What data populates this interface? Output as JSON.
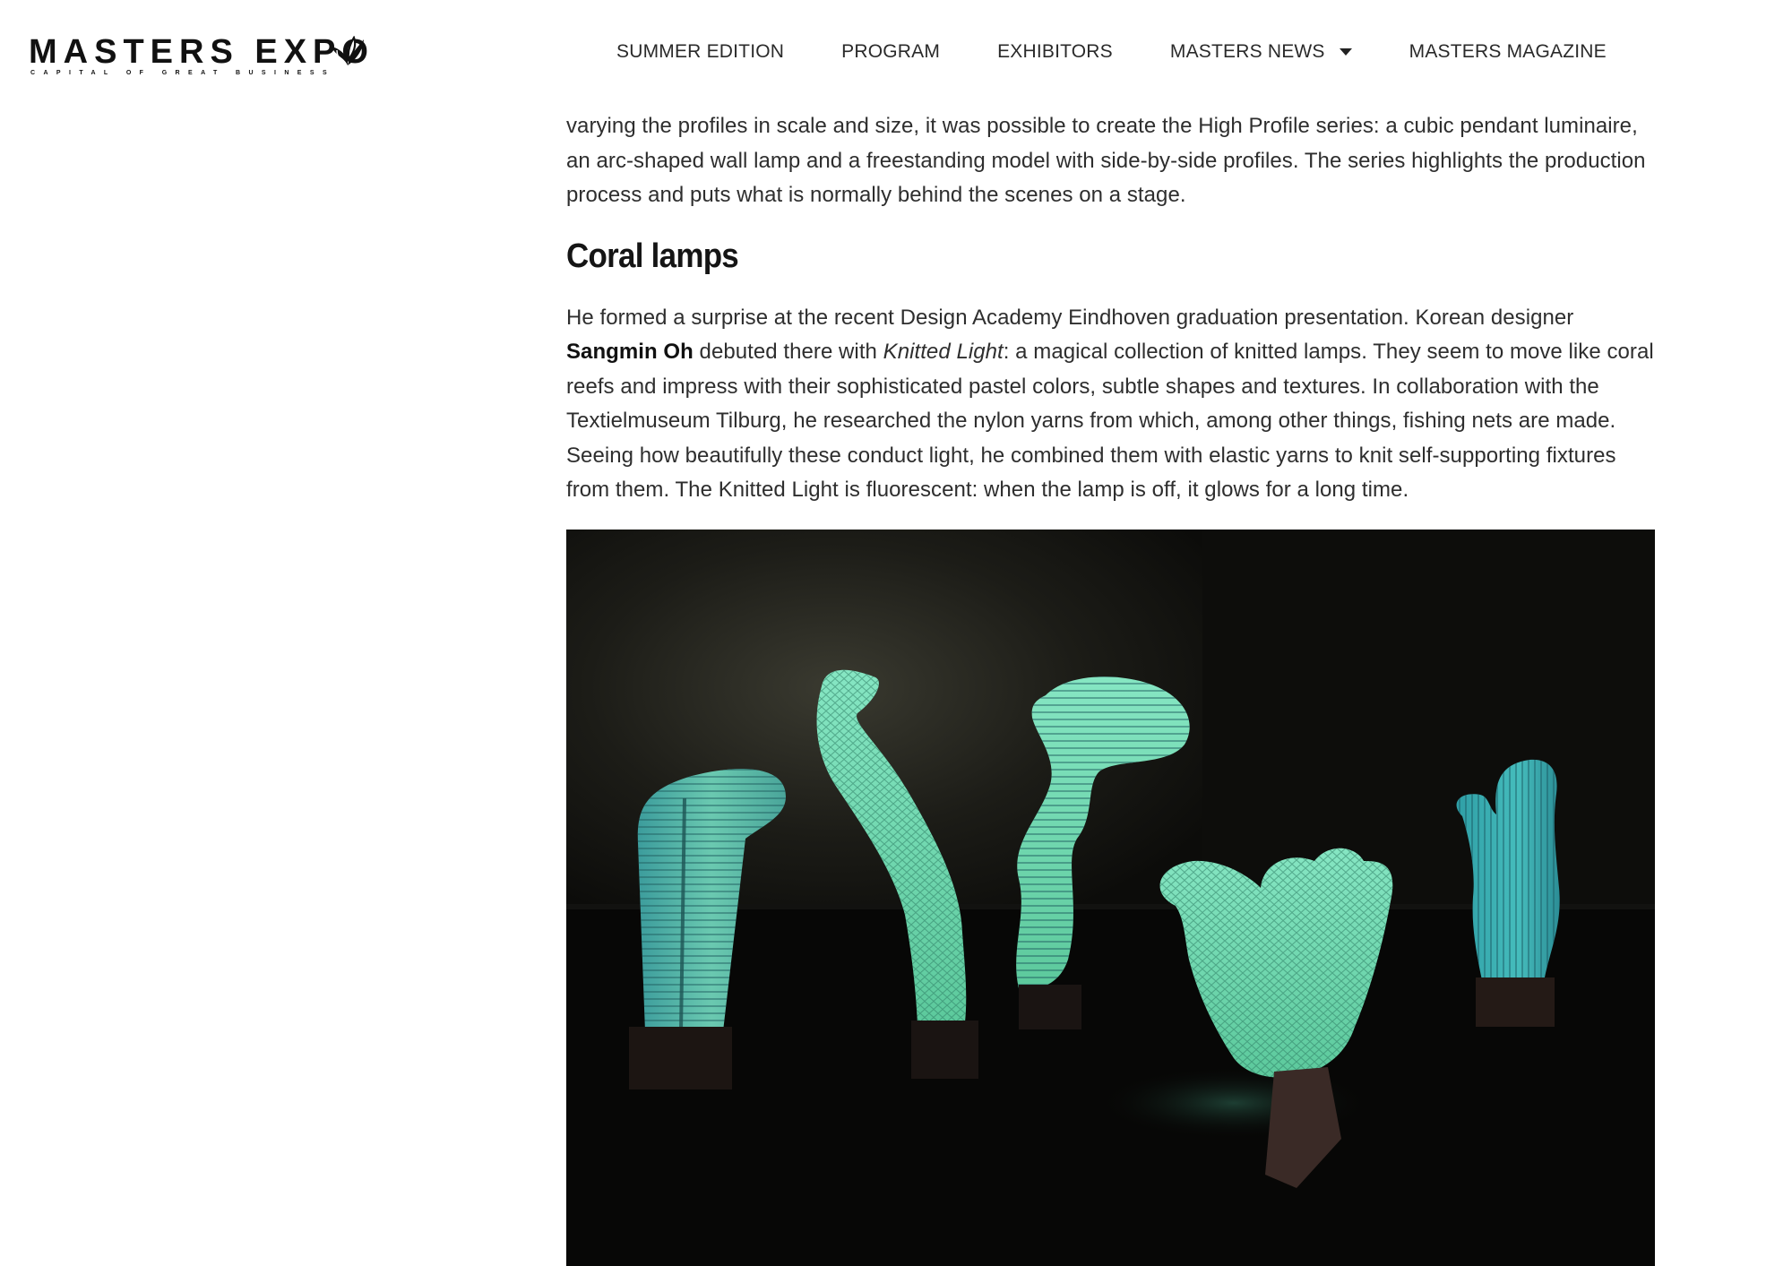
{
  "header": {
    "logo": {
      "wordmark": "MASTERS EXPO",
      "tagline": "CAPITAL OF GREAT BUSINESS"
    },
    "nav": [
      {
        "label": "SUMMER EDITION"
      },
      {
        "label": "PROGRAM"
      },
      {
        "label": "EXHIBITORS"
      },
      {
        "label": "MASTERS NEWS",
        "has_dropdown": true
      },
      {
        "label": "MASTERS MAGAZINE"
      }
    ]
  },
  "article": {
    "intro_paragraph": "varying the profiles in scale and size, it was possible to create the High Profile series: a cubic pendant luminaire, an arc-shaped wall lamp and a freestanding model with side-by-side profiles. The series highlights the production process and puts what is normally behind the scenes on a stage.",
    "section_heading": "Coral lamps",
    "body": {
      "lead": "He formed a surprise at the recent Design Academy Eindhoven graduation presentation. Korean designer ",
      "designer": "Sangmin Oh",
      "mid": " debuted there with ",
      "work_title": "Knitted Light",
      "rest": ": a magical collection of knitted lamps. They seem to move like coral reefs and impress with their sophisticated pastel colors, subtle shapes and textures. In collaboration with the Textielmuseum Tilburg, he researched the nylon yarns from which, among other things, fishing nets are made. Seeing how beautifully these conduct light, he combined them with elastic yarns to knit self-supporting fixtures from them. The Knitted Light is fluorescent: when the lamp is off, it glows for a long time."
    }
  },
  "colors": {
    "lamp_mint": "#6fd4a8",
    "lamp_teal": "#3fb6b4",
    "photo_bg": "#0a0a08"
  }
}
